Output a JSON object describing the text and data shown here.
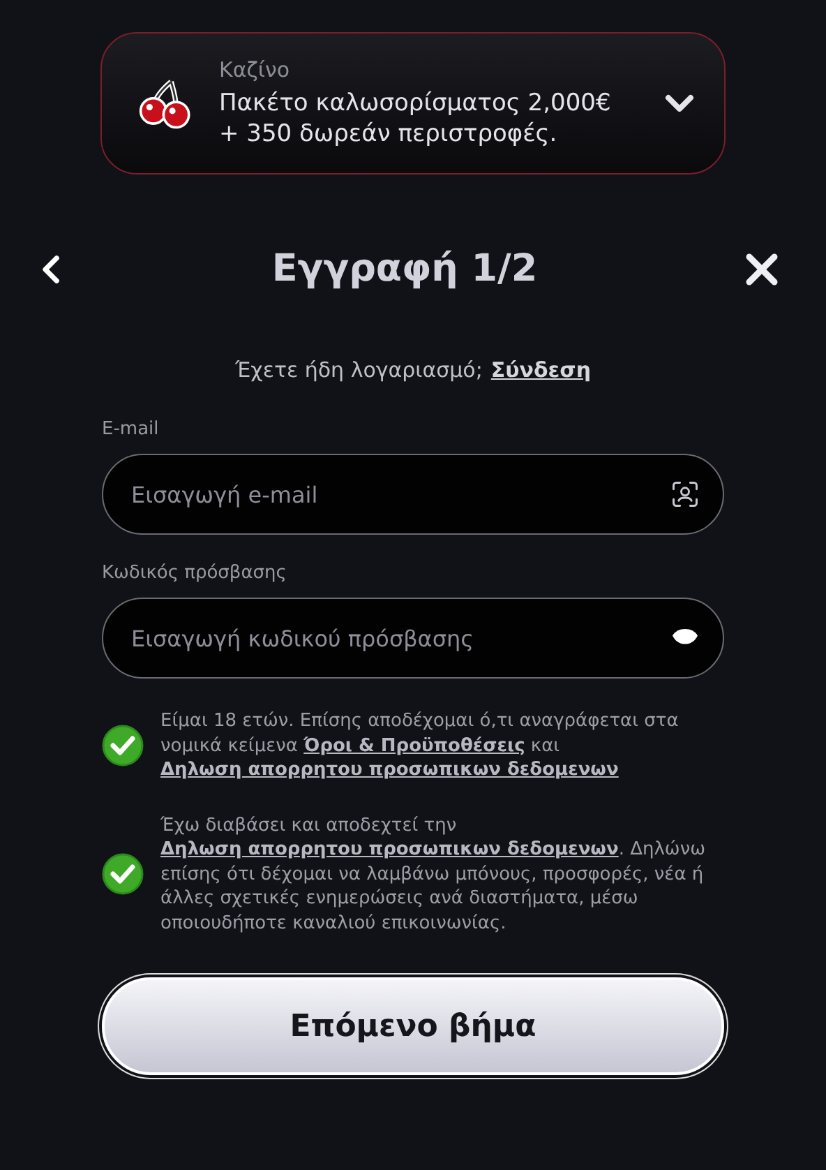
{
  "promo": {
    "category": "Καζίνο",
    "text": "Πακέτο καλωσορίσματος 2,000€ + 350 δωρεάν περιστροφές.",
    "expanded": false
  },
  "header": {
    "title": "Εγγραφή 1/2"
  },
  "login_prompt": {
    "text": "Έχετε ήδη λογαριασμό;",
    "link": "Σύνδεση"
  },
  "fields": [
    {
      "label": "E-mail",
      "placeholder": "Εισαγωγή e-mail",
      "kind": "email"
    },
    {
      "label": "Κωδικός πρόσβασης",
      "placeholder": "Εισαγωγή κωδικού πρόσβασης",
      "kind": "password"
    }
  ],
  "consents": [
    {
      "checked": true,
      "parts": [
        {
          "kind": "text",
          "text": "Είμαι 18 ετών. Επίσης αποδέχομαι ό,τι αναγράφεται στα νομικά κείμενα "
        },
        {
          "kind": "link",
          "text": "Όροι & Προϋποθέσεις"
        },
        {
          "kind": "text",
          "text": " και "
        },
        {
          "kind": "link",
          "text": "Δηλωση απορρητου προσωπικων δεδομενων"
        }
      ]
    },
    {
      "checked": true,
      "parts": [
        {
          "kind": "text",
          "text": "Έχω διαβάσει και αποδεχτεί την "
        },
        {
          "kind": "link",
          "text": "Δηλωση απορρητου προσωπικων δεδομενων"
        },
        {
          "kind": "text",
          "text": ". Δηλώνω επίσης ότι δέχομαι να λαμβάνω μπόνους, προσφορές, νέα ή άλλες σχετικές ενημερώσεις ανά διαστήματα, μέσω οποιουδήποτε καναλιού επικοινωνίας."
        }
      ]
    }
  ],
  "next_button": "Επόμενο βήμα"
}
